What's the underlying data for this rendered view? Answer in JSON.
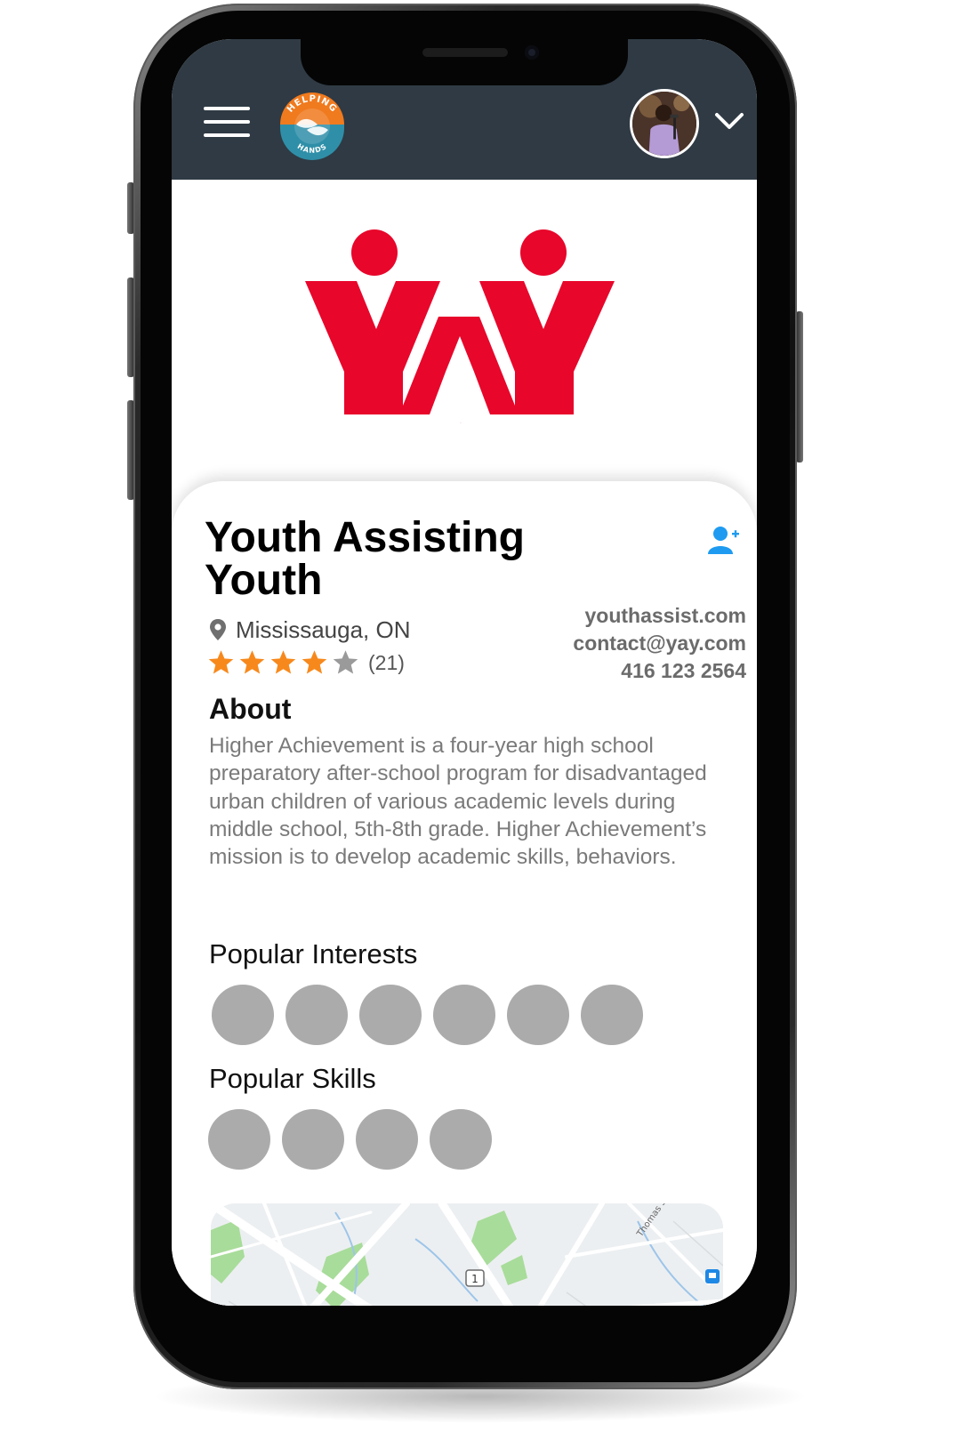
{
  "app": {
    "logo_text_top": "HELPING",
    "logo_text_bottom": "HANDS",
    "menu_icon": "hamburger-icon",
    "account_icon": "chevron-down-icon"
  },
  "organization": {
    "logo_text": "YAY",
    "name": "Youth Assisting Youth",
    "location": "Mississauga, ON",
    "rating": 4,
    "rating_max": 5,
    "review_count": "(21)",
    "website": "youthassist.com",
    "email": "contact@yay.com",
    "phone": "416 123 2564"
  },
  "about": {
    "title": "About",
    "text": "Higher Achievement is a four-year high school preparatory after-school program for disadvantaged urban children of various academic levels during middle school, 5th-8th grade. Higher Achievement’s mission is to develop academic skills, behaviors."
  },
  "interests": {
    "title": "Popular Interests",
    "count": 6
  },
  "skills": {
    "title": "Popular Skills",
    "count": 4
  },
  "map": {
    "street_label": "Thomas St",
    "route_shield": "1"
  },
  "colors": {
    "header_bg": "#2f3a44",
    "brand_red": "#e8062b",
    "brand_orange": "#f07a1e",
    "brand_teal": "#2f8fa8",
    "star_filled": "#f7891c",
    "star_empty": "#9a9a9a",
    "follow_blue": "#1e9bf0",
    "bubble_grey": "#ababab"
  }
}
